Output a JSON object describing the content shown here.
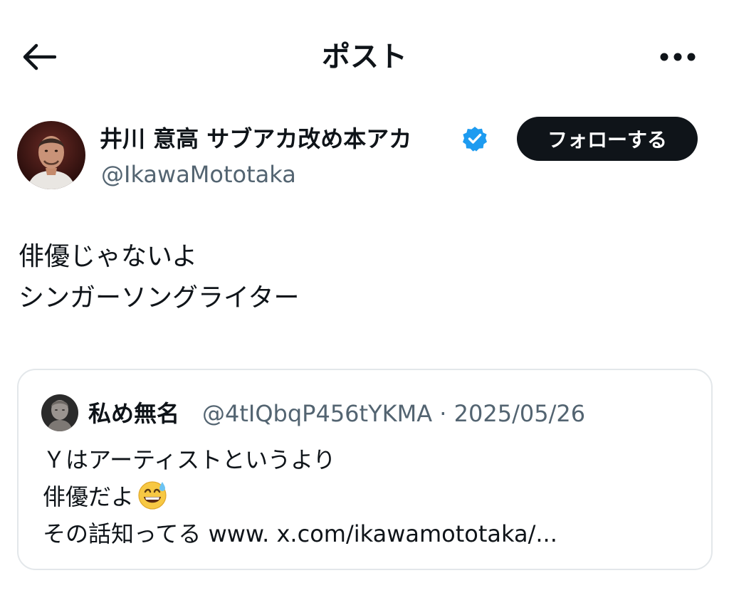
{
  "header": {
    "title": "ポスト",
    "back_icon": "arrow-left-icon",
    "more_icon": "ellipsis-horizontal-icon"
  },
  "author": {
    "display_name": "井川 意高 サブアカ改め本アカ",
    "handle": "@IkawaMototaka",
    "verified": true,
    "verified_color": "#1d9bf0",
    "follow_label": "フォローする"
  },
  "post": {
    "lines": [
      "俳優じゃないよ",
      "シンガーソングライター"
    ]
  },
  "quote": {
    "name": "私め無名",
    "meta": "@4tIQbqP456tYKMA · 2025/05/26",
    "lines": [
      "Ｙはアーティストというより",
      "俳優だよ",
      "その話知ってる www. x.com/ikawamototaka/..."
    ],
    "emoji": "grinning-face-with-sweat-icon"
  },
  "colors": {
    "text": "#0f1419",
    "secondary": "#536471",
    "border": "#e3e7ea",
    "button_bg": "#0f1419"
  }
}
